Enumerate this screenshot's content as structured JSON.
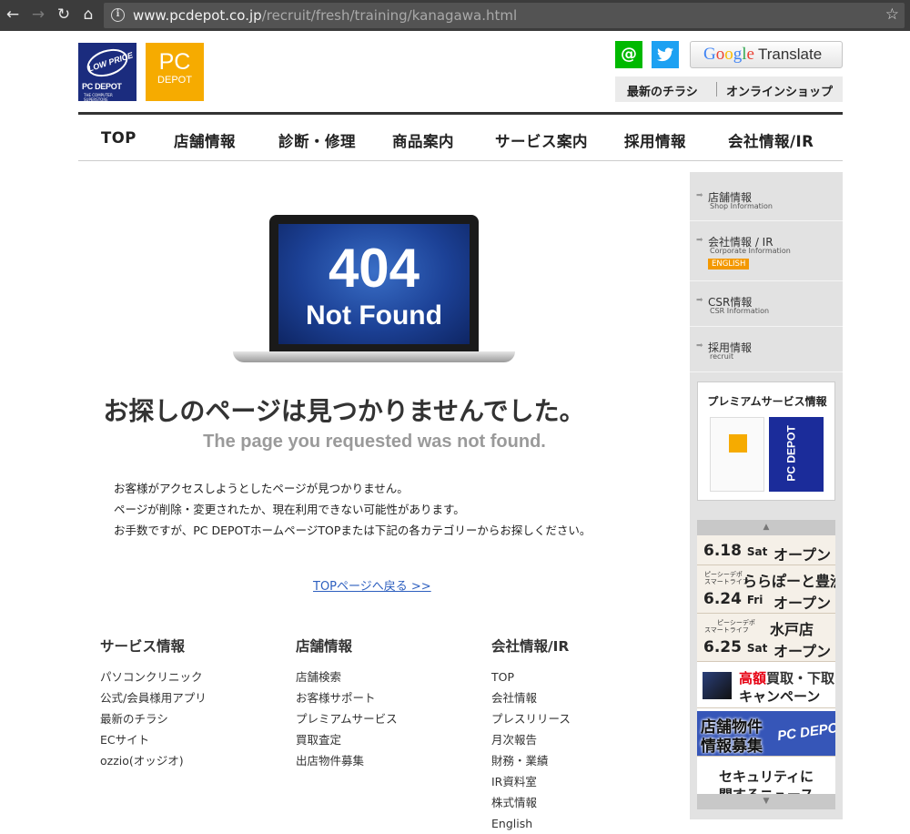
{
  "browser": {
    "url_host": "www.pcdepot.co.jp",
    "url_path": "/recruit/fresh/training/kanagawa.html"
  },
  "header": {
    "logo_blue_top": "LOW PRICE",
    "logo_blue_brand": "PC DEPOT",
    "logo_blue_sub": "THE COMPUTER SUPERSTORE",
    "logo_yellow_pc": "PC",
    "logo_yellow_depot": "DEPOT",
    "translate_google": "Google",
    "translate_label": "Translate",
    "flyer_label": "最新のチラシ",
    "shop_label": "オンラインショップ"
  },
  "nav": [
    "TOP",
    "店舗情報",
    "診断・修理",
    "商品案内",
    "サービス案内",
    "採用情報",
    "会社情報/IR"
  ],
  "error": {
    "screen_code": "404",
    "screen_text": "Not Found",
    "title_jp": "お探しのページは見つかりませんでした。",
    "title_en": "The page you requested was not found.",
    "body": [
      "お客様がアクセスしようとしたページが見つかりません。",
      "ページが削除・変更されたか、現在利用できない可能性があります。",
      "お手数ですが、PC DEPOTホームページTOPまたは下記の各カテゴリーからお探しください。"
    ],
    "top_link": "TOPページへ戻る >>"
  },
  "footer": {
    "col1": {
      "title": "サービス情報",
      "items": [
        "パソコンクリニック",
        "公式/会員様用アプリ",
        "最新のチラシ",
        "ECサイト",
        "ozzio(オッジオ)"
      ]
    },
    "col2": {
      "title": "店舗情報",
      "items": [
        "店舗検索",
        "お客様サポート",
        "プレミアムサービス",
        "買取査定",
        "出店物件募集"
      ]
    },
    "col3": {
      "title": "会社情報/IR",
      "items": [
        "TOP",
        "会社情報",
        "プレスリリース",
        "月次報告",
        "財務・業績",
        "IR資料室",
        "株式情報",
        "English"
      ]
    }
  },
  "sidebar": {
    "items": [
      {
        "title": "店舗情報",
        "sub": "Shop Information"
      },
      {
        "title": "会社情報 / IR",
        "sub": "Corporate Information",
        "badge": "ENGLISH"
      },
      {
        "title": "CSR情報",
        "sub": "CSR Information"
      },
      {
        "title": "採用情報",
        "sub": "recruit"
      }
    ],
    "premium_title": "プレミアムサービス情報",
    "premium_card_text": "PC DEPOT",
    "banners": [
      {
        "date": "6.18",
        "day": "Sat",
        "open": "オープン"
      },
      {
        "small1": "ピーシーデポ",
        "small2": "スマートライフ",
        "name": "ららぽーと豊洲",
        "date": "6.24",
        "day": "Fri",
        "open": "オープン"
      },
      {
        "small1": "ピーシーデポ",
        "small2": "スマートライフ",
        "name": "水戸店",
        "date": "6.25",
        "day": "Sat",
        "open": "オープン"
      }
    ],
    "campaign_red": "高額",
    "campaign_rest": "買取・下取",
    "campaign_l2": "キャンペーン",
    "property_l1": "店舗物件",
    "property_l2": "情報募集",
    "property_brand": "PC DEPOT",
    "security_l1": "セキュリティに",
    "security_l2": "関するニュース"
  },
  "icons": [
    "back-arrow-icon",
    "forward-arrow-icon",
    "reload-icon",
    "home-icon",
    "info-icon",
    "star-icon",
    "line-icon",
    "twitter-icon"
  ]
}
